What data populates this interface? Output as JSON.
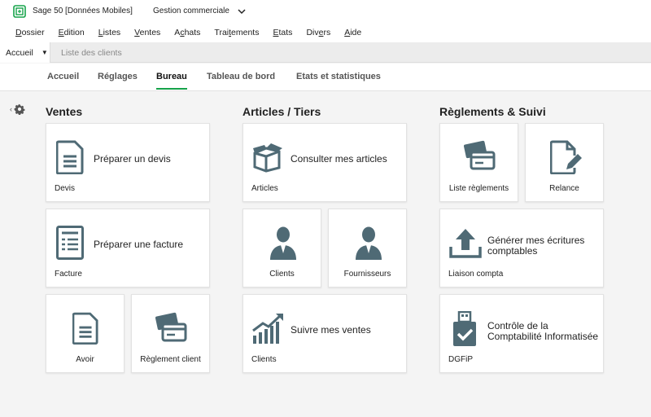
{
  "titlebar": {
    "app_title": "Sage 50 [Données Mobiles]",
    "module": "Gestion commerciale"
  },
  "menu": [
    {
      "u": "D",
      "rest": "ossier"
    },
    {
      "u": "E",
      "rest": "dition"
    },
    {
      "u": "L",
      "rest": "istes"
    },
    {
      "u": "V",
      "rest": "entes"
    },
    {
      "pre": "A",
      "u": "c",
      "rest": "hats"
    },
    {
      "pre": "Trai",
      "u": "t",
      "rest": "ements"
    },
    {
      "u": "E",
      "rest": "tats"
    },
    {
      "pre": "Div",
      "u": "e",
      "rest": "rs"
    },
    {
      "u": "A",
      "rest": "ide"
    }
  ],
  "tabs": {
    "home": "Accueil",
    "clients": "Liste des clients"
  },
  "subnav": [
    "Accueil",
    "Réglages",
    "Bureau",
    "Tableau de bord",
    "Etats et statistiques"
  ],
  "sections": {
    "ventes": "Ventes",
    "articles": "Articles / Tiers",
    "reglements": "Règlements & Suivi"
  },
  "tiles": {
    "devis": {
      "text": "Préparer un devis",
      "label": "Devis"
    },
    "facture": {
      "text": "Préparer une facture",
      "label": "Facture"
    },
    "avoir": {
      "label": "Avoir"
    },
    "reglement_client": {
      "label": "Règlement client"
    },
    "articles": {
      "text": "Consulter mes articles",
      "label": "Articles"
    },
    "clients": {
      "label": "Clients"
    },
    "fournisseurs": {
      "label": "Fournisseurs"
    },
    "ventes": {
      "text": "Suivre mes ventes",
      "label": "Clients"
    },
    "liste_reglements": {
      "label": "Liste règlements"
    },
    "relance": {
      "label": "Relance"
    },
    "liaison": {
      "text_line1": "Générer mes écritures",
      "text_line2": "comptables",
      "label": "Liaison compta"
    },
    "dgfip": {
      "text_line1": "Contrôle de la",
      "text_line2": "Comptabilité Informatisée",
      "label": "DGFiP"
    }
  },
  "colors": {
    "accent": "#16a34a",
    "icon": "#4f6a75"
  }
}
